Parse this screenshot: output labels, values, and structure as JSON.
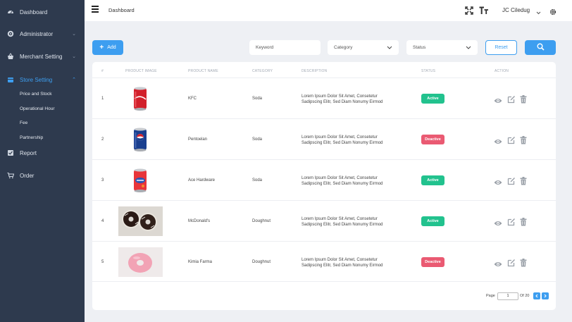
{
  "sidebar": {
    "items": [
      {
        "label": "Dashboard",
        "icon": "dashboard-icon"
      },
      {
        "label": "Administrator",
        "icon": "gear-icon"
      },
      {
        "label": "Merchant Setting",
        "icon": "basket-icon"
      },
      {
        "label": "Store Setting",
        "icon": "store-icon"
      },
      {
        "label": "Report",
        "icon": "report-icon"
      },
      {
        "label": "Order",
        "icon": "cart-icon"
      }
    ],
    "sub_items": [
      "Price and Stock",
      "Operational Hour",
      "Fee",
      "Partnership"
    ]
  },
  "topbar": {
    "breadcrumb": "Dashboard",
    "user_name": "JC Ciledug"
  },
  "filters": {
    "add_label": "Add",
    "keyword_placeholder": "Keyword",
    "category_value": "Category",
    "status_value": "Status",
    "reset_label": "Reset"
  },
  "table": {
    "headers": [
      "#",
      "PRODUCT IMAGE",
      "PRODUCT NAME",
      "CATEGORY",
      "DESCRIPTION",
      "STATUS",
      "ACTION"
    ],
    "rows": [
      {
        "no": "1",
        "name": "KFC",
        "category": "Soda",
        "desc1": "Lorem Ipsum Dolor Sit Amet, Consetetur",
        "desc2": "Sadipscing Elitr, Sed Diam Nonumy Eirmod",
        "status": "Active",
        "image": "cola-can"
      },
      {
        "no": "2",
        "name": "Pentoelan",
        "category": "Soda",
        "desc1": "Lorem Ipsum Dolor Sit Amet, Consetetur",
        "desc2": "Sadipscing Elitr, Sed Diam Nonumy Eirmod",
        "status": "Deactive",
        "image": "pepsi-can"
      },
      {
        "no": "3",
        "name": "Ace Hardware",
        "category": "Soda",
        "desc1": "Lorem Ipsum Dolor Sit Amet, Consetetur",
        "desc2": "Sadipscing Elitr, Sed Diam Nonumy Eirmod",
        "status": "Active",
        "image": "fanta-can"
      },
      {
        "no": "4",
        "name": "McDonald's",
        "category": "Doughnut",
        "desc1": "Lorem Ipsum Dolor Sit Amet, Consetetur",
        "desc2": "Sadipscing Elitr, Sed Diam Nonumy Eirmod",
        "status": "Active",
        "image": "chocolate-doughnuts"
      },
      {
        "no": "5",
        "name": "Kimia Farma",
        "category": "Doughnut",
        "desc1": "Lorem Ipsum Dolor Sit Amet, Consetetur",
        "desc2": "Sadipscing Elitr, Sed Diam Nonumy Eirmod",
        "status": "Deactive",
        "image": "pink-doughnut"
      }
    ]
  },
  "pagination": {
    "page_label": "Page",
    "current_page": "1",
    "of_label": "Of 20"
  },
  "colors": {
    "sidebar_bg": "#2e3a4e",
    "accent": "#3d9ef0",
    "active_badge": "#22c28e",
    "deactive_badge": "#ea5a72"
  }
}
